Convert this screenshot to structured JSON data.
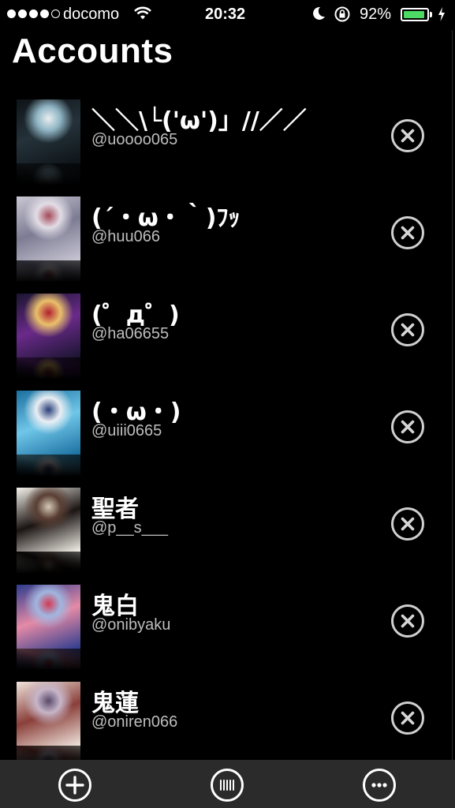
{
  "status_bar": {
    "carrier": "docomo",
    "time": "20:32",
    "battery_percent": "92%",
    "battery_level": 0.92,
    "signal_bars_filled": 4,
    "signal_bars_total": 5
  },
  "page": {
    "title": "Accounts"
  },
  "accounts": [
    {
      "name": "＼＼\\└('ω')」//／／",
      "handle": "@uoooo065",
      "avatar_colors": [
        "#0e1418",
        "#25323a",
        "#8fb4c4",
        "#e8eef0"
      ]
    },
    {
      "name": "(´・ω・｀)ﾌｯ",
      "handle": "@huu066",
      "avatar_colors": [
        "#c9c7d3",
        "#7c7b93",
        "#e2dde6",
        "#a34a58"
      ]
    },
    {
      "name": "(゜д゜)",
      "handle": "@ha06655",
      "avatar_colors": [
        "#1a1530",
        "#6a2a8a",
        "#e9c06a",
        "#b02030"
      ]
    },
    {
      "name": "(・ω・)",
      "handle": "@uiii0665",
      "avatar_colors": [
        "#1a6fa0",
        "#6fc6e8",
        "#e9eef3",
        "#2a3f7a"
      ]
    },
    {
      "name": "聖者",
      "handle": "@p__s___",
      "avatar_colors": [
        "#f4f1ea",
        "#1a1412",
        "#5a3f34",
        "#d4c9b7"
      ]
    },
    {
      "name": "鬼白",
      "handle": "@onibyaku",
      "avatar_colors": [
        "#2d3c8e",
        "#e58aa6",
        "#9fb6e0",
        "#d43a56"
      ]
    },
    {
      "name": "鬼蓮",
      "handle": "@oniren066",
      "avatar_colors": [
        "#efe4dc",
        "#8a3f3a",
        "#c7b6c9",
        "#5a4a6a"
      ]
    }
  ],
  "icons": {
    "remove": "close-circle-icon",
    "add": "add-circle-icon",
    "accounts_list": "columns-icon",
    "more": "more-dots-icon"
  },
  "colors": {
    "background": "#000000",
    "toolbar": "#2b2b2b",
    "battery_green": "#4cd964",
    "handle_text": "#bdbdbd"
  }
}
